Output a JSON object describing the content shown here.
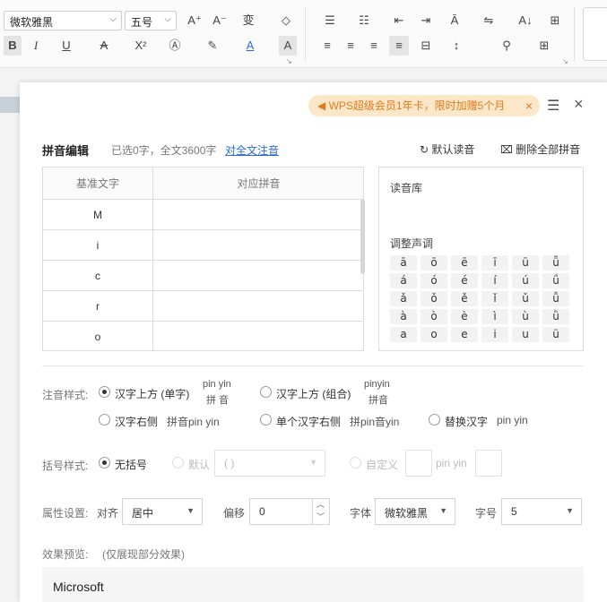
{
  "ribbon": {
    "font_name": "微软雅黑",
    "font_size": "五号",
    "row1": [
      "A⁺",
      "A⁻",
      "变",
      "◇",
      "☰",
      "☷",
      "⇤",
      "⇥",
      "Ā",
      "⇋",
      "A↓",
      "⊞"
    ],
    "row2": [
      "B",
      "I",
      "U",
      "A",
      "X²",
      "Ⓐ",
      "✎",
      "A",
      "A",
      "≡",
      "≡",
      "≡",
      "≡",
      "⊟",
      "↕",
      "⚲",
      "⊞"
    ]
  },
  "promo": {
    "text": "WPS超级会员1年卡，限时加赠5个月",
    "close": "×"
  },
  "dialog": {
    "menu_icon": "☰",
    "close_icon": "×",
    "title": "拼音编辑",
    "info": "已选0字，全文3600字",
    "link": "对全文注音",
    "default_reading": "默认读音",
    "delete_all": "删除全部拼音",
    "refresh_icon": "↻",
    "trash_icon": "🗑"
  },
  "table": {
    "headers": [
      "基准文字",
      "对应拼音"
    ],
    "rows": [
      "M",
      "i",
      "c",
      "r",
      "o"
    ]
  },
  "right_panel": {
    "library_label": "读音库",
    "tone_label": "调整声调",
    "tones": [
      [
        "ā",
        "ō",
        "ē",
        "ī",
        "ū",
        "ǖ"
      ],
      [
        "á",
        "ó",
        "é",
        "í",
        "ú",
        "ǘ"
      ],
      [
        "ǎ",
        "ǒ",
        "ě",
        "ǐ",
        "ǔ",
        "ǚ"
      ],
      [
        "à",
        "ò",
        "è",
        "ì",
        "ù",
        "ǜ"
      ],
      [
        "a",
        "o",
        "e",
        "i",
        "u",
        "ü"
      ]
    ]
  },
  "notation": {
    "label": "注音样式:",
    "options": [
      {
        "text": "汉字上方 (单字)",
        "demo_top": "pin yin",
        "demo_bottom": "拼 音"
      },
      {
        "text": "汉字上方 (组合)",
        "demo_top": "pinyin",
        "demo_bottom": "拼音"
      },
      {
        "text": "汉字右侧",
        "demo": "拼音pin yin"
      },
      {
        "text": "单个汉字右侧",
        "demo": "拼pin音yin"
      },
      {
        "text": "替换汉字",
        "demo": "pin yin"
      }
    ]
  },
  "bracket": {
    "label": "括号样式:",
    "none": "无括号",
    "default": "默认",
    "default_value": "( )",
    "custom": "自定义",
    "custom_demo": "pin yin"
  },
  "props": {
    "label": "属性设置:",
    "align_label": "对齐",
    "align_value": "居中",
    "offset_label": "偏移",
    "offset_value": "0",
    "font_label": "字体",
    "font_value": "微软雅黑",
    "size_label": "字号",
    "size_value": "5"
  },
  "preview": {
    "label": "效果预览:",
    "note": "(仅展现部分效果)",
    "text": "Microsoft"
  },
  "colors": {
    "accent": "#2a6ad9",
    "promo_bg": "#fde7c9",
    "promo_fg": "#e07b19"
  }
}
